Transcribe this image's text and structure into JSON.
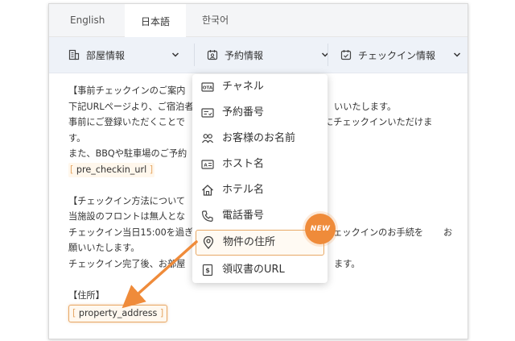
{
  "tabs": [
    {
      "label": "English"
    },
    {
      "label": "日本語"
    },
    {
      "label": "한국어"
    }
  ],
  "toolbar": {
    "room": "部屋情報",
    "reservation": "予約情報",
    "checkin": "チェックイン情報"
  },
  "content": {
    "l1": "【事前チェックインのご案内",
    "l2a": "下記URLページより、ご宿泊者",
    "l2b": "いいたします。",
    "l3a": "事前にご登録いただくことで",
    "l3b": "にチェックインいただけま",
    "l4": "す。",
    "l5": "また、BBQや駐車場のご予約",
    "var1": "pre_checkin_url",
    "l7": "【チェックイン方法について",
    "l8": "当施設のフロントは無人とな",
    "l9a": "チェックイン当日15:00を過ぎ",
    "l9b": "チェックインのお手続を",
    "l9c": "お",
    "l10": "願いいたします。",
    "l11a": "チェックイン完了後、",
    "l11b": "お部屋",
    "l11c": "ます。",
    "l13": "【住所】",
    "var2": "property_address"
  },
  "dropdown": {
    "items": [
      {
        "label": "チャネル",
        "icon": "ota-icon"
      },
      {
        "label": "予約番号",
        "icon": "ticket-icon"
      },
      {
        "label": "お客様のお名前",
        "icon": "guests-icon"
      },
      {
        "label": "ホスト名",
        "icon": "id-card-icon"
      },
      {
        "label": "ホテル名",
        "icon": "house-icon"
      },
      {
        "label": "電話番号",
        "icon": "phone-icon"
      },
      {
        "label": "物件の住所",
        "icon": "location-pin-icon"
      },
      {
        "label": "領収書のURL",
        "icon": "receipt-icon"
      }
    ],
    "new_badge": "NEW"
  },
  "colors": {
    "accent": "#ef8b3a",
    "highlight_border": "#e8a866",
    "toolbar_bg": "#eef2f8"
  }
}
